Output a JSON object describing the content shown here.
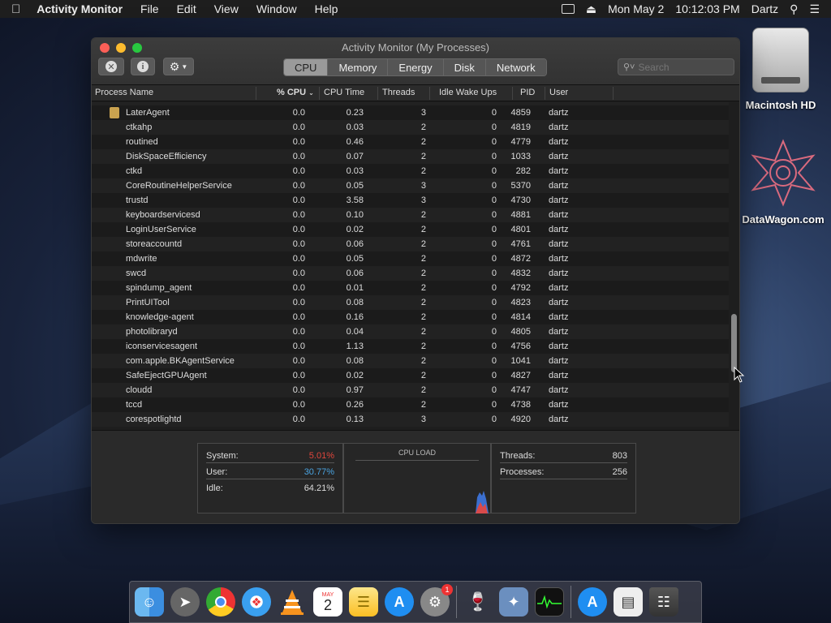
{
  "menubar": {
    "app_name": "Activity Monitor",
    "menus": [
      "File",
      "Edit",
      "View",
      "Window",
      "Help"
    ],
    "date": "Mon May 2",
    "time": "10:12:03 PM",
    "user": "Dartz"
  },
  "desktop": {
    "hd_label": "Macintosh HD",
    "wagon_label": "DataWagon.com"
  },
  "window": {
    "title": "Activity Monitor (My Processes)",
    "tabs": [
      "CPU",
      "Memory",
      "Energy",
      "Disk",
      "Network"
    ],
    "active_tab": "CPU",
    "search_placeholder": "Search"
  },
  "columns": {
    "name": "Process Name",
    "cpu": "% CPU",
    "cpu_time": "CPU Time",
    "threads": "Threads",
    "idle": "Idle Wake Ups",
    "pid": "PID",
    "user": "User"
  },
  "rows": [
    {
      "name": "LaterAgent",
      "cpu": "0.0",
      "time": "0.23",
      "threads": "3",
      "idle": "0",
      "pid": "4859",
      "user": "dartz"
    },
    {
      "name": "ctkahp",
      "cpu": "0.0",
      "time": "0.03",
      "threads": "2",
      "idle": "0",
      "pid": "4819",
      "user": "dartz"
    },
    {
      "name": "routined",
      "cpu": "0.0",
      "time": "0.46",
      "threads": "2",
      "idle": "0",
      "pid": "4779",
      "user": "dartz"
    },
    {
      "name": "DiskSpaceEfficiency",
      "cpu": "0.0",
      "time": "0.07",
      "threads": "2",
      "idle": "0",
      "pid": "1033",
      "user": "dartz"
    },
    {
      "name": "ctkd",
      "cpu": "0.0",
      "time": "0.03",
      "threads": "2",
      "idle": "0",
      "pid": "282",
      "user": "dartz"
    },
    {
      "name": "CoreRoutineHelperService",
      "cpu": "0.0",
      "time": "0.05",
      "threads": "3",
      "idle": "0",
      "pid": "5370",
      "user": "dartz"
    },
    {
      "name": "trustd",
      "cpu": "0.0",
      "time": "3.58",
      "threads": "3",
      "idle": "0",
      "pid": "4730",
      "user": "dartz"
    },
    {
      "name": "keyboardservicesd",
      "cpu": "0.0",
      "time": "0.10",
      "threads": "2",
      "idle": "0",
      "pid": "4881",
      "user": "dartz"
    },
    {
      "name": "LoginUserService",
      "cpu": "0.0",
      "time": "0.02",
      "threads": "2",
      "idle": "0",
      "pid": "4801",
      "user": "dartz"
    },
    {
      "name": "storeaccountd",
      "cpu": "0.0",
      "time": "0.06",
      "threads": "2",
      "idle": "0",
      "pid": "4761",
      "user": "dartz"
    },
    {
      "name": "mdwrite",
      "cpu": "0.0",
      "time": "0.05",
      "threads": "2",
      "idle": "0",
      "pid": "4872",
      "user": "dartz"
    },
    {
      "name": "swcd",
      "cpu": "0.0",
      "time": "0.06",
      "threads": "2",
      "idle": "0",
      "pid": "4832",
      "user": "dartz"
    },
    {
      "name": "spindump_agent",
      "cpu": "0.0",
      "time": "0.01",
      "threads": "2",
      "idle": "0",
      "pid": "4792",
      "user": "dartz"
    },
    {
      "name": "PrintUITool",
      "cpu": "0.0",
      "time": "0.08",
      "threads": "2",
      "idle": "0",
      "pid": "4823",
      "user": "dartz"
    },
    {
      "name": "knowledge-agent",
      "cpu": "0.0",
      "time": "0.16",
      "threads": "2",
      "idle": "0",
      "pid": "4814",
      "user": "dartz"
    },
    {
      "name": "photolibraryd",
      "cpu": "0.0",
      "time": "0.04",
      "threads": "2",
      "idle": "0",
      "pid": "4805",
      "user": "dartz"
    },
    {
      "name": "iconservicesagent",
      "cpu": "0.0",
      "time": "1.13",
      "threads": "2",
      "idle": "0",
      "pid": "4756",
      "user": "dartz"
    },
    {
      "name": "com.apple.BKAgentService",
      "cpu": "0.0",
      "time": "0.08",
      "threads": "2",
      "idle": "0",
      "pid": "1041",
      "user": "dartz"
    },
    {
      "name": "SafeEjectGPUAgent",
      "cpu": "0.0",
      "time": "0.02",
      "threads": "2",
      "idle": "0",
      "pid": "4827",
      "user": "dartz"
    },
    {
      "name": "cloudd",
      "cpu": "0.0",
      "time": "0.97",
      "threads": "2",
      "idle": "0",
      "pid": "4747",
      "user": "dartz"
    },
    {
      "name": "tccd",
      "cpu": "0.0",
      "time": "0.26",
      "threads": "2",
      "idle": "0",
      "pid": "4738",
      "user": "dartz"
    },
    {
      "name": "corespotlightd",
      "cpu": "0.0",
      "time": "0.13",
      "threads": "3",
      "idle": "0",
      "pid": "4920",
      "user": "dartz"
    }
  ],
  "stats": {
    "system_label": "System:",
    "system_value": "5.01%",
    "system_color": "#e0463c",
    "user_label": "User:",
    "user_value": "30.77%",
    "user_color": "#4aa3e0",
    "idle_label": "Idle:",
    "idle_value": "64.21%",
    "cpu_load_label": "CPU LOAD",
    "threads_label": "Threads:",
    "threads_value": "803",
    "processes_label": "Processes:",
    "processes_value": "256"
  },
  "dock": {
    "calendar_month": "MAY",
    "calendar_day": "2",
    "appstore_badge": "1"
  }
}
